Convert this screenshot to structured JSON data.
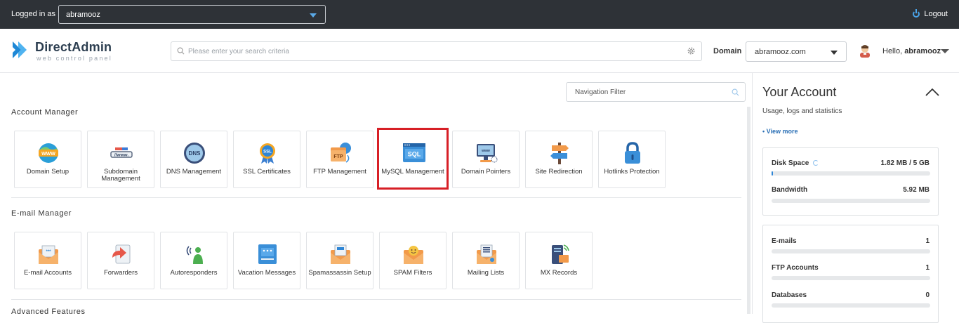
{
  "topbar": {
    "logged_in_label": "Logged in as",
    "user": "abramooz",
    "logout_label": "Logout"
  },
  "header": {
    "brand_name": "DirectAdmin",
    "brand_sub": "web control panel",
    "search_placeholder": "Please enter your search criteria",
    "domain_label": "Domain",
    "domain_value": "abramooz.com",
    "hello_prefix": "Hello,",
    "hello_user": "abramooz"
  },
  "main": {
    "nav_filter_placeholder": "Navigation Filter",
    "sections": [
      {
        "title": "Account Manager",
        "tiles": [
          {
            "label": "Domain Setup",
            "icon": "www-globe-icon"
          },
          {
            "label": "Subdomain Management",
            "icon": "subdomain-icon"
          },
          {
            "label": "DNS Management",
            "icon": "dns-globe-icon"
          },
          {
            "label": "SSL Certificates",
            "icon": "ssl-badge-icon"
          },
          {
            "label": "FTP Management",
            "icon": "ftp-folder-icon"
          },
          {
            "label": "MySQL Management",
            "icon": "sql-window-icon",
            "highlighted": true
          },
          {
            "label": "Domain Pointers",
            "icon": "monitor-pointer-icon"
          },
          {
            "label": "Site Redirection",
            "icon": "signpost-icon"
          },
          {
            "label": "Hotlinks Protection",
            "icon": "padlock-icon"
          }
        ]
      },
      {
        "title": "E-mail Manager",
        "tiles": [
          {
            "label": "E-mail Accounts",
            "icon": "envelope-icon"
          },
          {
            "label": "Forwarders",
            "icon": "forward-arrow-icon"
          },
          {
            "label": "Autoresponders",
            "icon": "autoresponder-icon"
          },
          {
            "label": "Vacation Messages",
            "icon": "vacation-message-icon"
          },
          {
            "label": "Spamassassin Setup",
            "icon": "spam-envelope-icon"
          },
          {
            "label": "SPAM Filters",
            "icon": "spam-filter-icon"
          },
          {
            "label": "Mailing Lists",
            "icon": "mailing-list-icon"
          },
          {
            "label": "MX Records",
            "icon": "mx-server-icon"
          }
        ]
      }
    ],
    "next_section_title": "Advanced Features"
  },
  "account": {
    "title": "Your Account",
    "subtitle": "Usage, logs and statistics",
    "view_more": "• View more",
    "usage": [
      {
        "label": "Disk Space",
        "value": "1.82 MB / 5 GB",
        "fraction": 0.004
      },
      {
        "label": "Bandwidth",
        "value": "5.92 MB",
        "fraction": 0
      }
    ],
    "counts": [
      {
        "label": "E-mails",
        "value": "1"
      },
      {
        "label": "FTP Accounts",
        "value": "1"
      },
      {
        "label": "Databases",
        "value": "0"
      }
    ]
  },
  "colors": {
    "topbar_bg": "#2e3237",
    "accent_blue": "#2f86d6",
    "highlight_red": "#d71f26"
  }
}
